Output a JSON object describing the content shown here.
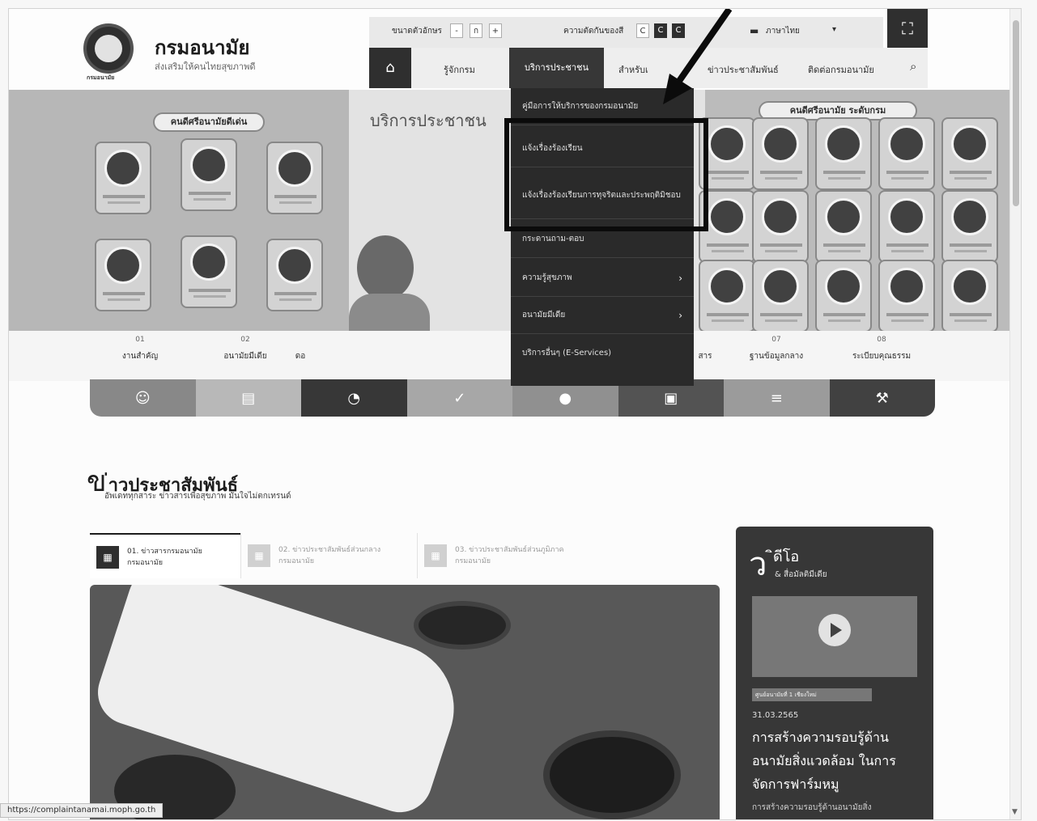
{
  "header": {
    "title": "กรมอนามัย",
    "subtitle": "ส่งเสริมให้คนไทยสุขภาพดี",
    "logo_caption": "กรมอนามัย"
  },
  "util": {
    "font_size_label": "ขนาดตัวอักษร",
    "font_minus": "-",
    "font_normal": "ก",
    "font_plus": "+",
    "contrast_label": "ความตัดกันของสี",
    "contrast_options": [
      "C",
      "C",
      "C"
    ],
    "language": "ภาษาไทย",
    "language_chevron": "▾"
  },
  "nav": {
    "items": [
      "รู้จักกรม",
      "บริการประชาชน",
      "สำหรับเ",
      "ข่าวประชาสัมพันธ์",
      "ติดต่อกรมอนามัย"
    ]
  },
  "hero": {
    "center_title": "บริการประชาชน",
    "left_banner": "คนดีศรีอนามัยดีเด่น",
    "right_banner": "คนดีศรีอนามัย ระดับกรม"
  },
  "dropdown": {
    "items": [
      {
        "label": "คู่มือการให้บริการของกรมอนามัย"
      },
      {
        "label": "แจ้งเรื่องร้องเรียน"
      },
      {
        "label": "แจ้งเรื่องร้องเรียนการทุจริตและประพฤติมิชอบ"
      },
      {
        "label": "กระดานถาม-ตอบ"
      },
      {
        "label": "ความรู้สุขภาพ"
      },
      {
        "label": "อนามัยมีเดีย"
      },
      {
        "label": "บริการอื่นๆ (E-Services)"
      }
    ]
  },
  "categories": [
    {
      "num": "01",
      "label": "งานสำคัญ"
    },
    {
      "num": "02",
      "label": "อนามัยมีเดีย"
    },
    {
      "num": "",
      "label": "ดอ"
    },
    {
      "num": "",
      "label": "สาร"
    },
    {
      "num": "07",
      "label": "ฐานข้อมูลกลาง"
    },
    {
      "num": "08",
      "label": "ระเบียบคุณธรรม"
    }
  ],
  "news": {
    "title_big": "ข",
    "title_rest": "่าวประชาสัมพันธ์",
    "subtitle": "อัพเดททุกสาระ ข่าวสารเพื่อสุขภาพ มั่นใจไม่ตกเทรนด์",
    "tabs": [
      {
        "line1": "01. ข่าวสารกรมอนามัย",
        "line2": "กรมอนามัย"
      },
      {
        "line1": "02. ข่าวประชาสัมพันธ์ส่วนกลาง",
        "line2": "กรมอนามัย"
      },
      {
        "line1": "03. ข่าวประชาสัมพันธ์ส่วนภูมิภาค",
        "line2": "กรมอนามัย"
      }
    ]
  },
  "video": {
    "big_letter": "ว",
    "title": "ิดีโอ",
    "subtitle": "& สื่อมัลติมีเดีย",
    "badge": "ศูนย์อนามัยที่ 1 เชียงใหม่",
    "date": "31.03.2565",
    "headline": "การสร้างความรอบรู้ด้านอนามัยสิ่งแวดล้อม ในการจัดการฟาร์มหมู",
    "excerpt": "การสร้างความรอบรู้ด้านอนามัยสิ่ง"
  },
  "status_url": "https://complaintanamai.moph.go.th"
}
